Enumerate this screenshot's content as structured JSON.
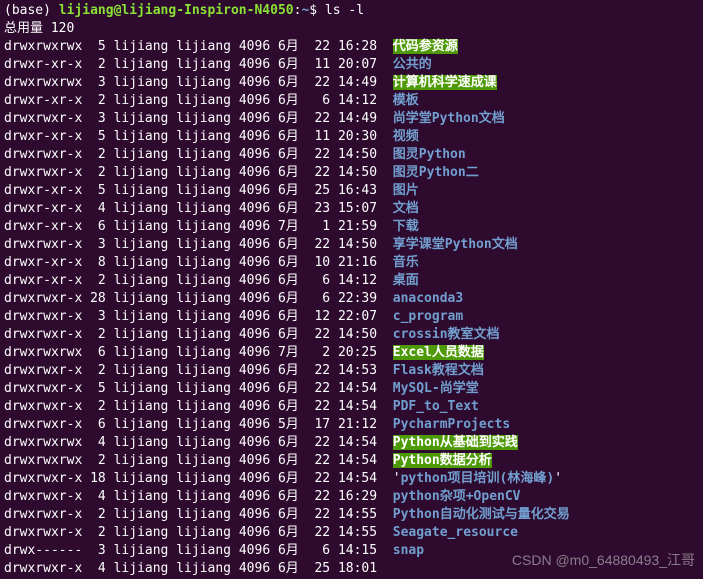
{
  "prompt": {
    "env": "base",
    "user_host": "lijiang@lijiang-Inspiron-N4050",
    "path": "~",
    "command": "ls -l"
  },
  "total": "总用量 120",
  "rows": [
    {
      "perm": "drwxrwxrwx",
      "links": "5",
      "owner": "lijiang",
      "group": "lijiang",
      "size": "4096",
      "month": "6月",
      "day": "22",
      "time": "16:28",
      "name": "代码参资源",
      "style": "hl"
    },
    {
      "perm": "drwxr-xr-x",
      "links": "2",
      "owner": "lijiang",
      "group": "lijiang",
      "size": "4096",
      "month": "6月",
      "day": "11",
      "time": "20:07",
      "name": "公共的",
      "style": "blue"
    },
    {
      "perm": "drwxrwxrwx",
      "links": "3",
      "owner": "lijiang",
      "group": "lijiang",
      "size": "4096",
      "month": "6月",
      "day": "22",
      "time": "14:49",
      "name": "计算机科学速成课",
      "style": "hl"
    },
    {
      "perm": "drwxr-xr-x",
      "links": "2",
      "owner": "lijiang",
      "group": "lijiang",
      "size": "4096",
      "month": "6月",
      "day": "6",
      "time": "14:12",
      "name": "模板",
      "style": "blue"
    },
    {
      "perm": "drwxrwxr-x",
      "links": "3",
      "owner": "lijiang",
      "group": "lijiang",
      "size": "4096",
      "month": "6月",
      "day": "22",
      "time": "14:49",
      "name": "尚学堂Python文档",
      "style": "blue"
    },
    {
      "perm": "drwxr-xr-x",
      "links": "5",
      "owner": "lijiang",
      "group": "lijiang",
      "size": "4096",
      "month": "6月",
      "day": "11",
      "time": "20:30",
      "name": "视频",
      "style": "blue"
    },
    {
      "perm": "drwxrwxr-x",
      "links": "2",
      "owner": "lijiang",
      "group": "lijiang",
      "size": "4096",
      "month": "6月",
      "day": "22",
      "time": "14:50",
      "name": "图灵Python",
      "style": "blue"
    },
    {
      "perm": "drwxrwxr-x",
      "links": "2",
      "owner": "lijiang",
      "group": "lijiang",
      "size": "4096",
      "month": "6月",
      "day": "22",
      "time": "14:50",
      "name": "图灵Python二",
      "style": "blue"
    },
    {
      "perm": "drwxr-xr-x",
      "links": "5",
      "owner": "lijiang",
      "group": "lijiang",
      "size": "4096",
      "month": "6月",
      "day": "25",
      "time": "16:43",
      "name": "图片",
      "style": "blue"
    },
    {
      "perm": "drwxr-xr-x",
      "links": "4",
      "owner": "lijiang",
      "group": "lijiang",
      "size": "4096",
      "month": "6月",
      "day": "23",
      "time": "15:07",
      "name": "文档",
      "style": "blue"
    },
    {
      "perm": "drwxr-xr-x",
      "links": "6",
      "owner": "lijiang",
      "group": "lijiang",
      "size": "4096",
      "month": "7月",
      "day": "1",
      "time": "21:59",
      "name": "下载",
      "style": "blue"
    },
    {
      "perm": "drwxrwxr-x",
      "links": "3",
      "owner": "lijiang",
      "group": "lijiang",
      "size": "4096",
      "month": "6月",
      "day": "22",
      "time": "14:50",
      "name": "享学课堂Python文档",
      "style": "blue"
    },
    {
      "perm": "drwxr-xr-x",
      "links": "8",
      "owner": "lijiang",
      "group": "lijiang",
      "size": "4096",
      "month": "6月",
      "day": "10",
      "time": "21:16",
      "name": "音乐",
      "style": "blue"
    },
    {
      "perm": "drwxr-xr-x",
      "links": "2",
      "owner": "lijiang",
      "group": "lijiang",
      "size": "4096",
      "month": "6月",
      "day": "6",
      "time": "14:12",
      "name": "桌面",
      "style": "blue"
    },
    {
      "perm": "drwxrwxr-x",
      "links": "28",
      "owner": "lijiang",
      "group": "lijiang",
      "size": "4096",
      "month": "6月",
      "day": "6",
      "time": "22:39",
      "name": "anaconda3",
      "style": "blue"
    },
    {
      "perm": "drwxrwxr-x",
      "links": "3",
      "owner": "lijiang",
      "group": "lijiang",
      "size": "4096",
      "month": "6月",
      "day": "12",
      "time": "22:07",
      "name": "c_program",
      "style": "blue"
    },
    {
      "perm": "drwxrwxr-x",
      "links": "2",
      "owner": "lijiang",
      "group": "lijiang",
      "size": "4096",
      "month": "6月",
      "day": "22",
      "time": "14:50",
      "name": "crossin教室文档",
      "style": "blue"
    },
    {
      "perm": "drwxrwxrwx",
      "links": "6",
      "owner": "lijiang",
      "group": "lijiang",
      "size": "4096",
      "month": "7月",
      "day": "2",
      "time": "20:25",
      "name": "Excel人员数据",
      "style": "hl"
    },
    {
      "perm": "drwxrwxr-x",
      "links": "2",
      "owner": "lijiang",
      "group": "lijiang",
      "size": "4096",
      "month": "6月",
      "day": "22",
      "time": "14:53",
      "name": "Flask教程文档",
      "style": "blue"
    },
    {
      "perm": "drwxrwxr-x",
      "links": "5",
      "owner": "lijiang",
      "group": "lijiang",
      "size": "4096",
      "month": "6月",
      "day": "22",
      "time": "14:54",
      "name": "MySQL-尚学堂",
      "style": "blue"
    },
    {
      "perm": "drwxrwxr-x",
      "links": "2",
      "owner": "lijiang",
      "group": "lijiang",
      "size": "4096",
      "month": "6月",
      "day": "22",
      "time": "14:54",
      "name": "PDF_to_Text",
      "style": "blue"
    },
    {
      "perm": "drwxrwxr-x",
      "links": "6",
      "owner": "lijiang",
      "group": "lijiang",
      "size": "4096",
      "month": "5月",
      "day": "17",
      "time": "21:12",
      "name": "PycharmProjects",
      "style": "blue"
    },
    {
      "perm": "drwxrwxrwx",
      "links": "4",
      "owner": "lijiang",
      "group": "lijiang",
      "size": "4096",
      "month": "6月",
      "day": "22",
      "time": "14:54",
      "name": "Python从基础到实践",
      "style": "hl"
    },
    {
      "perm": "drwxrwxrwx",
      "links": "2",
      "owner": "lijiang",
      "group": "lijiang",
      "size": "4096",
      "month": "6月",
      "day": "22",
      "time": "14:54",
      "name": "Python数据分析",
      "style": "hl"
    },
    {
      "perm": "drwxrwxr-x",
      "links": "18",
      "owner": "lijiang",
      "group": "lijiang",
      "size": "4096",
      "month": "6月",
      "day": "22",
      "time": "14:54",
      "name": "python项目培训(林海峰)",
      "style": "blue",
      "quoted": true
    },
    {
      "perm": "drwxrwxr-x",
      "links": "4",
      "owner": "lijiang",
      "group": "lijiang",
      "size": "4096",
      "month": "6月",
      "day": "22",
      "time": "16:29",
      "name": "python杂项+OpenCV",
      "style": "blue"
    },
    {
      "perm": "drwxrwxr-x",
      "links": "2",
      "owner": "lijiang",
      "group": "lijiang",
      "size": "4096",
      "month": "6月",
      "day": "22",
      "time": "14:55",
      "name": "Python自动化测试与量化交易",
      "style": "blue"
    },
    {
      "perm": "drwxrwxr-x",
      "links": "2",
      "owner": "lijiang",
      "group": "lijiang",
      "size": "4096",
      "month": "6月",
      "day": "22",
      "time": "14:55",
      "name": "Seagate_resource",
      "style": "blue"
    },
    {
      "perm": "drwx------",
      "links": "3",
      "owner": "lijiang",
      "group": "lijiang",
      "size": "4096",
      "month": "6月",
      "day": "6",
      "time": "14:15",
      "name": "snap",
      "style": "blue"
    },
    {
      "perm": "drwxrwxr-x",
      "links": "4",
      "owner": "lijiang",
      "group": "lijiang",
      "size": "4096",
      "month": "6月",
      "day": "25",
      "time": "18:01",
      "name": "",
      "style": "blue"
    }
  ],
  "watermark": "CSDN @m0_64880493_江哥"
}
